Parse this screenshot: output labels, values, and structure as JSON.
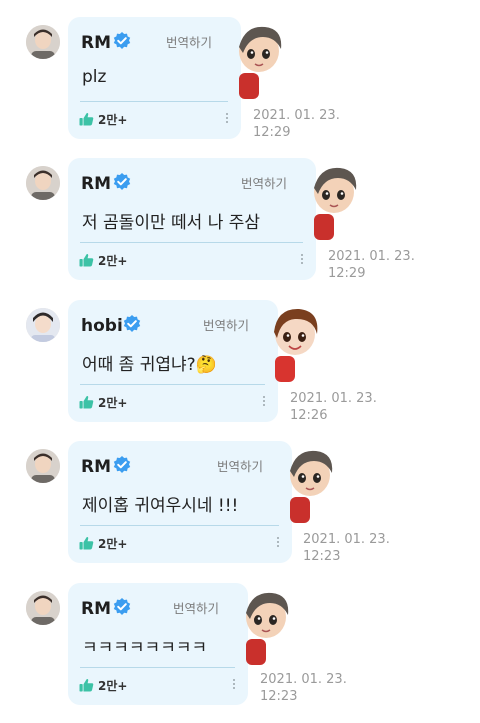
{
  "messages": [
    {
      "author": "RM",
      "verified": true,
      "translate_label": "번역하기",
      "text": "plz",
      "likes": "2만+",
      "timestamp": "2021. 01. 23.\n12:29",
      "character_icon": "rj-character-peek-icon"
    },
    {
      "author": "RM",
      "verified": true,
      "translate_label": "번역하기",
      "text": "저 곰돌이만 떼서 나 주삼",
      "likes": "2만+",
      "timestamp": "2021. 01. 23.\n12:29",
      "character_icon": "rj-character-peek-icon"
    },
    {
      "author": "hobi",
      "verified": true,
      "translate_label": "번역하기",
      "text": "어때 좀 귀엽냐?🤔",
      "likes": "2만+",
      "timestamp": "2021. 01. 23.\n12:26",
      "character_icon": "hobi-character-peek-icon"
    },
    {
      "author": "RM",
      "verified": true,
      "translate_label": "번역하기",
      "text": "제이홉 귀여우시네 !!!",
      "likes": "2만+",
      "timestamp": "2021. 01. 23.\n12:23",
      "character_icon": "rj-character-peek-icon"
    },
    {
      "author": "RM",
      "verified": true,
      "translate_label": "번역하기",
      "text": "ㅋㅋㅋㅋㅋㅋㅋㅋ",
      "likes": "2만+",
      "timestamp": "2021. 01. 23.\n12:23",
      "character_icon": "rj-character-peek-icon"
    }
  ],
  "colors": {
    "bubble": "#eaf6fd",
    "verified": "#3b9df0",
    "like": "#3cc2a6",
    "timestamp": "#9a9a9a"
  }
}
